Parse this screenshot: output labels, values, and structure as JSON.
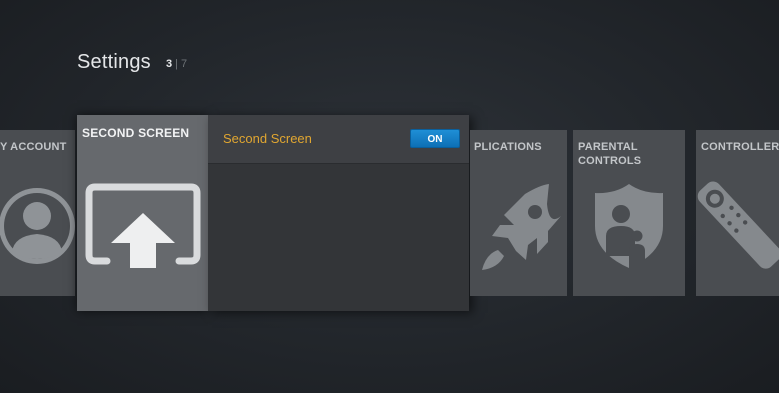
{
  "header": {
    "title": "Settings",
    "page_current": "3",
    "page_separator": "|",
    "page_total": "7"
  },
  "tiles": {
    "my_account": {
      "label": "Y ACCOUNT",
      "icon": "person-icon"
    },
    "second_screen": {
      "label": "SECOND SCREEN",
      "icon": "screen-mirror-icon"
    },
    "applications": {
      "label": "PLICATIONS",
      "icon": "rocket-icon"
    },
    "parental_controls": {
      "label": "PARENTAL\nCONTROLS",
      "label_line1": "PARENTAL",
      "label_line2": "CONTROLS",
      "icon": "shield-family-icon"
    },
    "controllers": {
      "label": "CONTROLLER",
      "icon": "remote-icon"
    }
  },
  "second_screen_panel": {
    "row_label": "Second Screen",
    "toggle_state": "ON"
  },
  "colors": {
    "accent_label": "#e0a631",
    "toggle_on": "#1f8fd6",
    "tile_bg": "#4a4d51",
    "tile_selected_bg": "#66696d"
  }
}
